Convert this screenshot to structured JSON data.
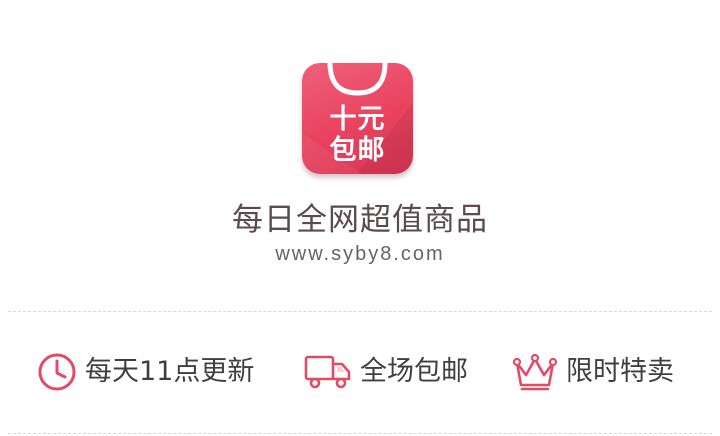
{
  "brand": {
    "icon_line1": "十元",
    "icon_line2": "包邮",
    "tagline": "每日全网超值商品",
    "website": "www.syby8.com",
    "accent_color": "#e8425e"
  },
  "features": [
    {
      "label": "每天11点更新",
      "icon": "clock-icon"
    },
    {
      "label": "全场包邮",
      "icon": "delivery-truck-icon"
    },
    {
      "label": "限时特卖",
      "icon": "crown-icon"
    }
  ]
}
